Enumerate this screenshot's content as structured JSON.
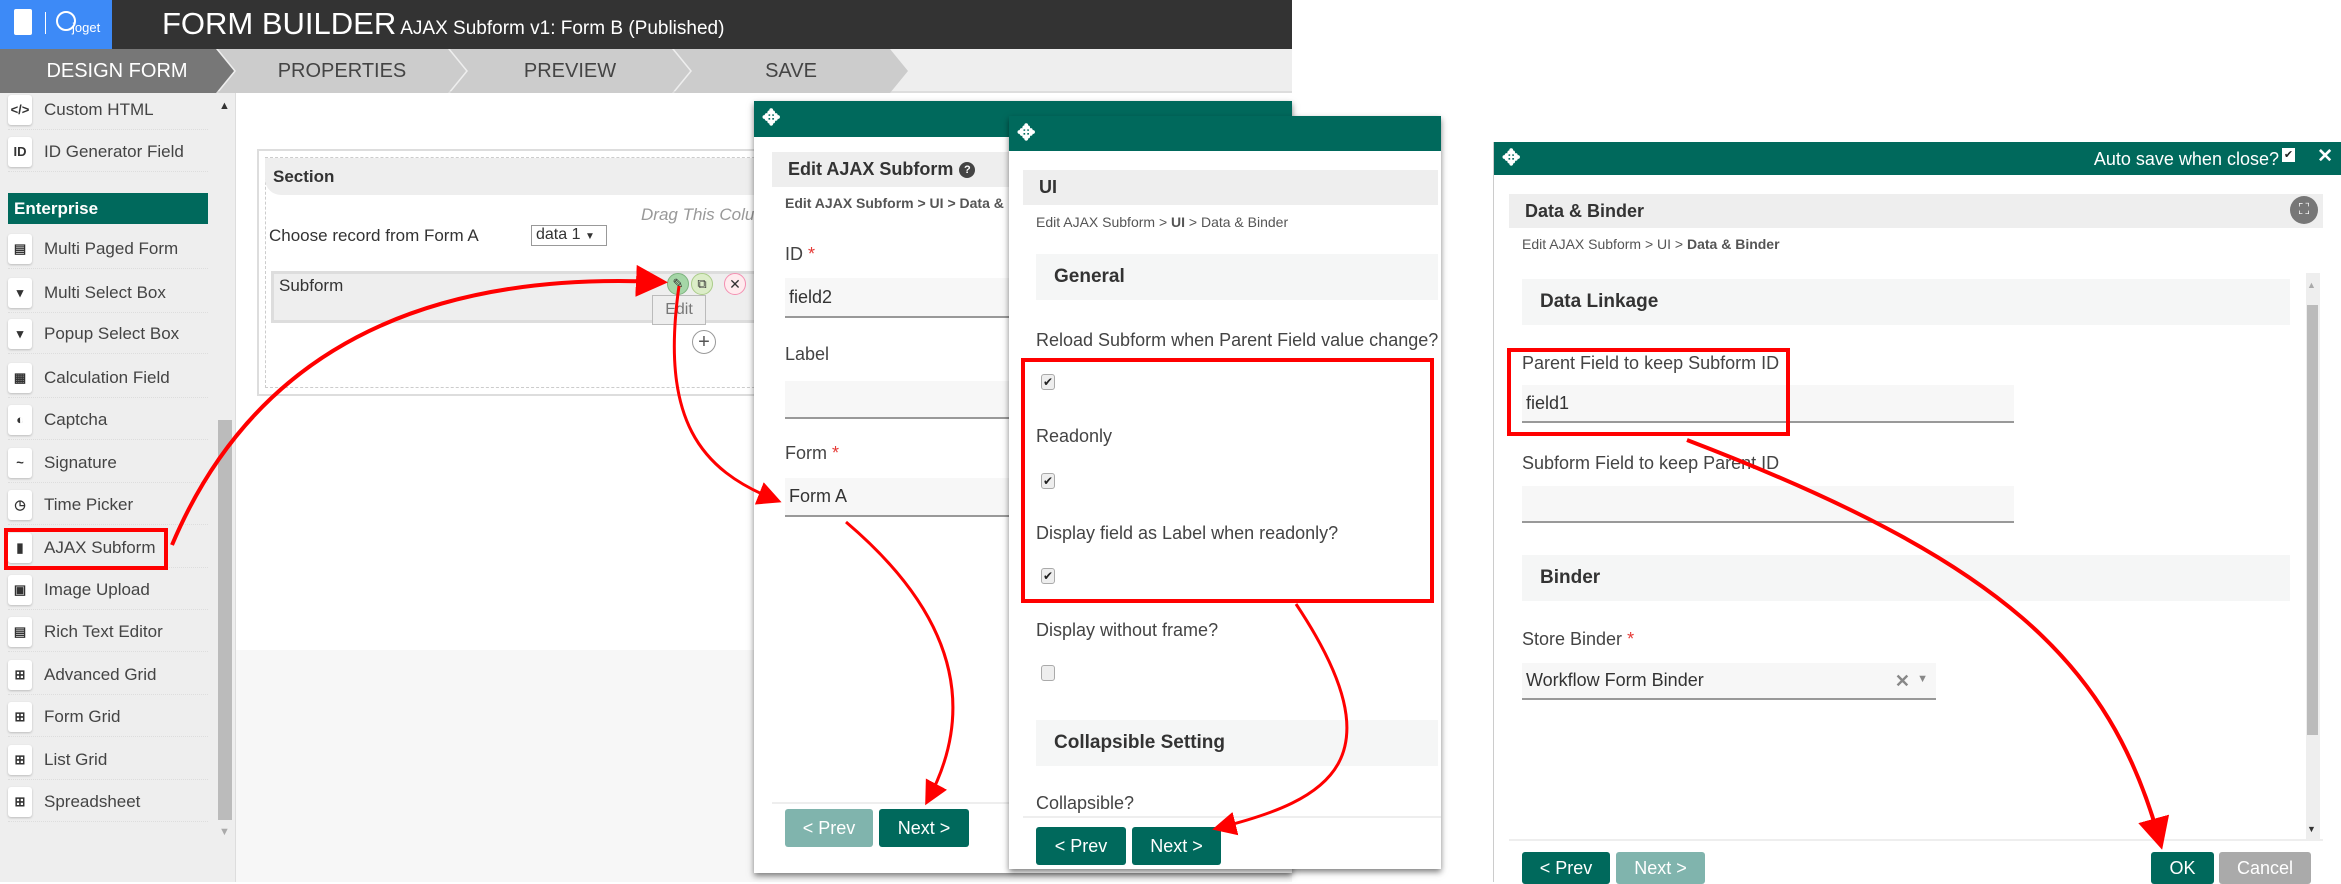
{
  "header": {
    "logo_text": "joget",
    "title": "FORM BUILDER",
    "subtitle": "AJAX Subform v1: Form B (Published)"
  },
  "nav": {
    "tabs": [
      {
        "label": "DESIGN FORM",
        "active": true
      },
      {
        "label": "PROPERTIES"
      },
      {
        "label": "PREVIEW"
      },
      {
        "label": "SAVE"
      }
    ]
  },
  "sidebar": {
    "items": [
      {
        "label": "Custom HTML",
        "icon": "code-icon",
        "glyph": "</>"
      },
      {
        "label": "ID Generator Field",
        "icon": "id-icon",
        "glyph": "ID"
      },
      {
        "label": "Enterprise",
        "header": true
      },
      {
        "label": "Multi Paged Form",
        "icon": "list-icon",
        "glyph": "▤"
      },
      {
        "label": "Multi Select Box",
        "icon": "dropdown-icon",
        "glyph": "▾"
      },
      {
        "label": "Popup Select Box",
        "icon": "dropdown-icon",
        "glyph": "▾"
      },
      {
        "label": "Calculation Field",
        "icon": "calculator-icon",
        "glyph": "▦"
      },
      {
        "label": "Captcha",
        "icon": "shield-icon",
        "glyph": "◐"
      },
      {
        "label": "Signature",
        "icon": "signature-icon",
        "glyph": "~"
      },
      {
        "label": "Time Picker",
        "icon": "clock-icon",
        "glyph": "◷"
      },
      {
        "label": "AJAX Subform",
        "icon": "file-icon",
        "glyph": "▮"
      },
      {
        "label": "Image Upload",
        "icon": "image-icon",
        "glyph": "▣"
      },
      {
        "label": "Rich Text Editor",
        "icon": "editor-icon",
        "glyph": "▤"
      },
      {
        "label": "Advanced Grid",
        "icon": "grid-icon",
        "glyph": "⊞"
      },
      {
        "label": "Form Grid",
        "icon": "grid-icon",
        "glyph": "⊞"
      },
      {
        "label": "List Grid",
        "icon": "grid-icon",
        "glyph": "⊞"
      },
      {
        "label": "Spreadsheet",
        "icon": "grid-icon",
        "glyph": "⊞"
      }
    ]
  },
  "canvas": {
    "section_title": "Section",
    "drag_hint": "Drag This Column",
    "choose_label": "Choose record from Form A",
    "select_value": "data 1",
    "subform_label": "Subform",
    "edit_tooltip": "Edit"
  },
  "dialog1": {
    "title": "Edit AJAX Subform",
    "breadcrumb": "Edit AJAX Subform > UI > Data &",
    "id_label": "ID",
    "id_value": "field2",
    "label_label": "Label",
    "label_value": "",
    "form_label": "Form",
    "form_value": "Form A",
    "prev": "< Prev",
    "next": "Next >"
  },
  "dialog2": {
    "title": "UI",
    "breadcrumb_a": "Edit AJAX Subform > ",
    "breadcrumb_b": "UI",
    "breadcrumb_c": " > Data & Binder",
    "general": "General",
    "reload_label": "Reload Subform when Parent Field value change?",
    "reload_checked": true,
    "readonly_label": "Readonly",
    "readonly_checked": true,
    "display_label": "Display field as Label when readonly?",
    "display_checked": true,
    "noframe_label": "Display without frame?",
    "noframe_checked": false,
    "collapsible_setting": "Collapsible Setting",
    "collapsible_label": "Collapsible?",
    "prev": "< Prev",
    "next": "Next >"
  },
  "dialog3": {
    "autosave": "Auto save when close?",
    "autosave_checked": true,
    "title": "Data & Binder",
    "breadcrumb_a": "Edit AJAX Subform > UI > ",
    "breadcrumb_b": "Data & Binder",
    "data_linkage": "Data Linkage",
    "parent_label": "Parent Field to keep Subform ID",
    "parent_value": "field1",
    "subform_field_label": "Subform Field to keep Parent ID",
    "subform_field_value": "",
    "binder": "Binder",
    "store_label": "Store Binder",
    "store_value": "Workflow Form Binder",
    "prev": "< Prev",
    "next": "Next >",
    "ok": "OK",
    "cancel": "Cancel"
  },
  "colors": {
    "accent": "#00695c",
    "annotation": "#ff0000",
    "logo_bg": "#3d8af7"
  }
}
